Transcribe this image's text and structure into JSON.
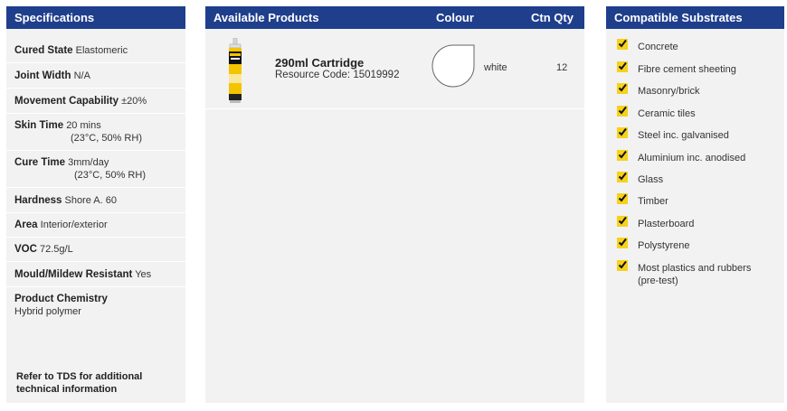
{
  "specifications": {
    "title": "Specifications",
    "rows": [
      {
        "label": "Cured State",
        "value": "Elastomeric"
      },
      {
        "label": "Joint Width",
        "value": "N/A"
      },
      {
        "label": "Movement Capability",
        "value": "±20%"
      },
      {
        "label": "Skin Time",
        "value": "20 mins",
        "note": "(23°C, 50% RH)"
      },
      {
        "label": "Cure Time",
        "value": "3mm/day",
        "note": "(23°C, 50% RH)"
      },
      {
        "label": "Hardness",
        "value": "Shore A. 60"
      },
      {
        "label": "Area",
        "value": "Interior/exterior"
      },
      {
        "label": "VOC",
        "value": "72.5g/L"
      },
      {
        "label": "Mould/Mildew Resistant",
        "value": "Yes"
      },
      {
        "label": "Product Chemistry",
        "value": "Hybrid polymer"
      }
    ],
    "footer": "Refer to TDS for additional technical information"
  },
  "products": {
    "title": "Available Products",
    "colour_header": "Colour",
    "qty_header": "Ctn Qty",
    "items": [
      {
        "name": "290ml Cartridge",
        "code_label": "Resource Code:",
        "code": "15019992",
        "colour": "white",
        "qty": "12",
        "swatch_color": "#ffffff"
      }
    ]
  },
  "substrates": {
    "title": "Compatible Substrates",
    "items": [
      "Concrete",
      "Fibre cement sheeting",
      "Masonry/brick",
      "Ceramic tiles",
      "Steel inc. galvanised",
      "Aluminium inc. anodised",
      "Glass",
      "Timber",
      "Plasterboard",
      "Polystyrene",
      "Most plastics and rubbers (pre-test)"
    ]
  },
  "colors": {
    "header": "#1f3f8c",
    "panel": "#f2f2f2",
    "check": "#f6d21a"
  }
}
